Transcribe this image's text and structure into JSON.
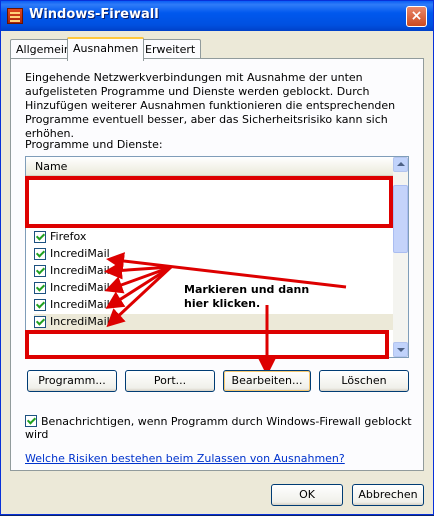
{
  "window": {
    "title": "Windows-Firewall",
    "close_label": "×"
  },
  "tabs": [
    {
      "label": "Allgemein"
    },
    {
      "label": "Ausnahmen"
    },
    {
      "label": "Erweitert"
    }
  ],
  "intro_text": "Eingehende Netzwerkverbindungen mit Ausnahme der unten aufgelisteten Programme und Dienste werden geblockt. Durch Hinzufügen weiterer Ausnahmen funktionieren die entsprechenden Programme eventuell besser, aber das Sicherheitsrisiko kann sich erhöhen.",
  "list": {
    "label": "Programme und Dienste:",
    "column_header": "Name",
    "items": [
      {
        "label": "Firefox",
        "checked": true
      },
      {
        "label": "IncrediMail",
        "checked": true
      },
      {
        "label": "IncrediMail",
        "checked": true
      },
      {
        "label": "IncrediMail",
        "checked": true
      },
      {
        "label": "IncrediMail",
        "checked": true
      },
      {
        "label": "IncrediMail",
        "checked": true
      }
    ]
  },
  "buttons": {
    "add_program": "Programm...",
    "add_port": "Port...",
    "edit": "Bearbeiten...",
    "delete": "Löschen",
    "ok": "OK",
    "cancel": "Abbrechen"
  },
  "notify_option": {
    "label": "Benachrichtigen, wenn Programm durch Windows-Firewall geblockt wird",
    "checked": true
  },
  "help_link": "Welche Risiken bestehen beim Zulassen von Ausnahmen?",
  "annotation": {
    "line1": "Markieren und dann",
    "line2": "hier klicken."
  },
  "colors": {
    "title_bar": "#0058ee",
    "annotation_red": "#dd0000",
    "face": "#ece9d8"
  }
}
